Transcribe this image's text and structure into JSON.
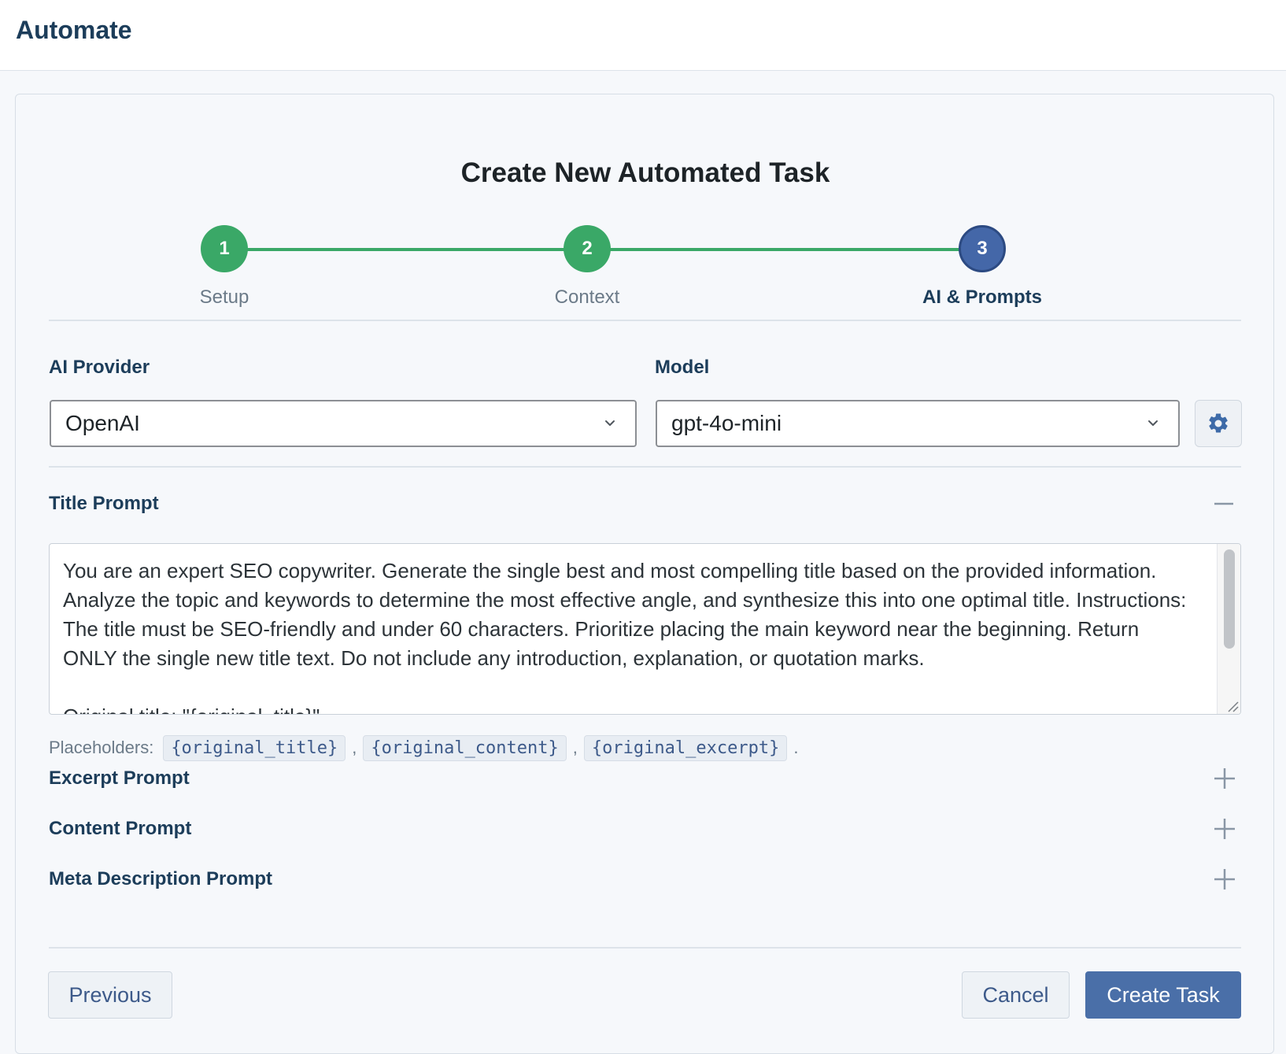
{
  "app": {
    "title": "Automate"
  },
  "page": {
    "title": "Create New Automated Task"
  },
  "stepper": {
    "steps": [
      {
        "number": "1",
        "label": "Setup",
        "status": "complete"
      },
      {
        "number": "2",
        "label": "Context",
        "status": "complete"
      },
      {
        "number": "3",
        "label": "AI & Prompts",
        "status": "active"
      }
    ]
  },
  "ai_provider": {
    "label": "AI Provider",
    "value": "OpenAI"
  },
  "model": {
    "label": "Model",
    "value": "gpt-4o-mini",
    "settings_icon": "gear-icon"
  },
  "title_prompt": {
    "label": "Title Prompt",
    "toggle_icon": "minus-icon",
    "value": "You are an expert SEO copywriter. Generate the single best and most compelling title based on the provided information. Analyze the topic and keywords to determine the most effective angle, and synthesize this into one optimal title. Instructions: The title must be SEO-friendly and under 60 characters. Prioritize placing the main keyword near the beginning. Return ONLY the single new title text. Do not include any introduction, explanation, or quotation marks.\n\nOriginal title: \"{original_title}\"",
    "placeholders_label": "Placeholders:",
    "placeholders": [
      "{original_title}",
      "{original_content}",
      "{original_excerpt}"
    ]
  },
  "collapsed_sections": [
    {
      "label": "Excerpt Prompt",
      "toggle_icon": "plus-icon"
    },
    {
      "label": "Content Prompt",
      "toggle_icon": "plus-icon"
    },
    {
      "label": "Meta Description Prompt",
      "toggle_icon": "plus-icon"
    }
  ],
  "footer": {
    "previous_label": "Previous",
    "cancel_label": "Cancel",
    "create_label": "Create Task"
  },
  "colors": {
    "step_complete": "#3aa867",
    "step_active": "#4467a8",
    "primary_button": "#4a6fa8",
    "heading": "#1c3d5a"
  }
}
